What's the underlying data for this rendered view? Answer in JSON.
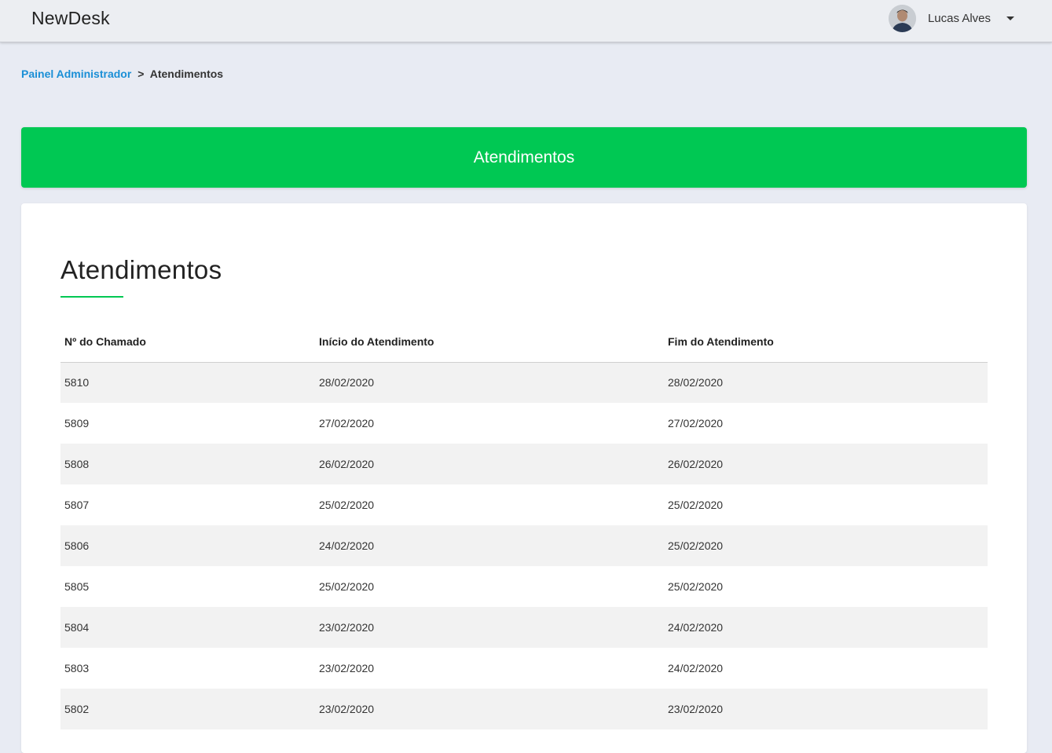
{
  "app": {
    "brand": "NewDesk"
  },
  "user": {
    "name": "Lucas Alves",
    "menu_icon": "chevron-down-icon"
  },
  "breadcrumb": {
    "parent": "Painel Administrador",
    "separator": ">",
    "current": "Atendimentos"
  },
  "banner": {
    "title": "Atendimentos"
  },
  "card": {
    "title": "Atendimentos"
  },
  "table": {
    "headers": [
      "Nº do Chamado",
      "Início do Atendimento",
      "Fim do Atendimento"
    ],
    "rows": [
      [
        "5810",
        "28/02/2020",
        "28/02/2020"
      ],
      [
        "5809",
        "27/02/2020",
        "27/02/2020"
      ],
      [
        "5808",
        "26/02/2020",
        "26/02/2020"
      ],
      [
        "5807",
        "25/02/2020",
        "25/02/2020"
      ],
      [
        "5806",
        "24/02/2020",
        "25/02/2020"
      ],
      [
        "5805",
        "25/02/2020",
        "25/02/2020"
      ],
      [
        "5804",
        "23/02/2020",
        "24/02/2020"
      ],
      [
        "5803",
        "23/02/2020",
        "24/02/2020"
      ],
      [
        "5802",
        "23/02/2020",
        "23/02/2020"
      ]
    ]
  },
  "colors": {
    "accent": "#00c853",
    "link": "#1a8fd6",
    "background": "#e8ebf3"
  }
}
